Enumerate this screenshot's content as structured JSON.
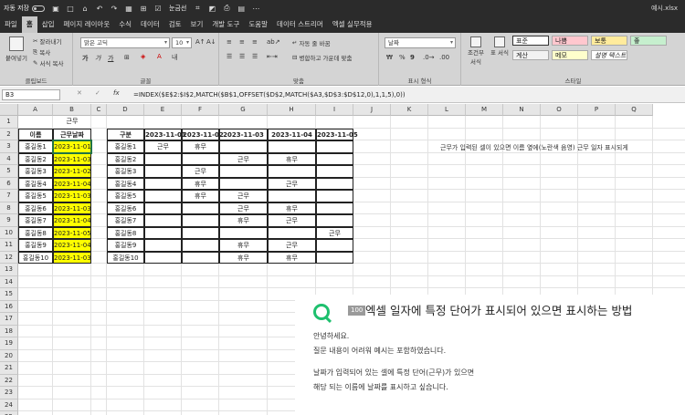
{
  "titlebar": {
    "autosave": "자동 저장",
    "font_indicator": "눈금선",
    "filename": "예시.xlsx"
  },
  "menu": {
    "tabs": [
      "파일",
      "홈",
      "삽입",
      "페이지 레이아웃",
      "수식",
      "데이터",
      "검토",
      "보기",
      "개발 도구",
      "도움말",
      "데이터 스트리머",
      "엑셀 실무적용"
    ],
    "active": "홈"
  },
  "ribbon": {
    "clipboard": {
      "label": "클립보드",
      "paste": "붙여넣기",
      "cut": "잘라내기",
      "copy": "복사",
      "format_painter": "서식 복사"
    },
    "font": {
      "label": "글꼴",
      "font_name": "맑은 고딕",
      "font_size": "10",
      "bold": "가",
      "italic": "가",
      "underline": "가"
    },
    "alignment": {
      "label": "맞춤",
      "wrap": "자동 줄 바꿈",
      "merge": "병합하고 가운데 맞춤"
    },
    "number": {
      "label": "표시 형식",
      "format": "날짜",
      "percent": "%",
      "comma": "9"
    },
    "styles": {
      "label": "스타일",
      "conditional": "조건부 서식",
      "table": "표 서식",
      "cells": [
        {
          "name": "표준",
          "color": "#ffffff"
        },
        {
          "name": "나쁨",
          "color": "#ffc7ce"
        },
        {
          "name": "보통",
          "color": "#ffeb9c"
        },
        {
          "name": "좋",
          "color": "#c6efce"
        },
        {
          "name": "계산",
          "color": "#f2f2f2"
        },
        {
          "name": "메모",
          "color": "#ffffcc"
        },
        {
          "name": "설명 텍스트",
          "color": "#ffffff"
        }
      ]
    }
  },
  "formula_bar": {
    "name_box": "B3",
    "formula": "=INDEX($E$2:$I$2,MATCH($B$1,OFFSET($D$2,MATCH($A3,$D$3:$D$12,0),1,1,5),0))"
  },
  "sheet": {
    "columns": [
      "A",
      "B",
      "C",
      "D",
      "E",
      "F",
      "G",
      "H",
      "I",
      "J",
      "K",
      "L",
      "M",
      "N",
      "O",
      "P",
      "Q"
    ],
    "rows": [
      "1",
      "2",
      "3",
      "4",
      "5",
      "6",
      "7",
      "8",
      "9",
      "10",
      "11",
      "12",
      "13",
      "14",
      "15",
      "16",
      "17",
      "18",
      "19",
      "20",
      "21",
      "22",
      "23",
      "24",
      "25"
    ],
    "b1": "근무",
    "left_headers": [
      "이름",
      "근무날짜"
    ],
    "left_rows": [
      [
        "홍길동1",
        "2023-11-01"
      ],
      [
        "홍길동2",
        "2023-11-03"
      ],
      [
        "홍길동3",
        "2023-11-02"
      ],
      [
        "홍길동4",
        "2023-11-04"
      ],
      [
        "홍길동5",
        "2023-11-03"
      ],
      [
        "홍길동6",
        "2023-11-03"
      ],
      [
        "홍길동7",
        "2023-11-04"
      ],
      [
        "홍길동8",
        "2023-11-05"
      ],
      [
        "홍길동9",
        "2023-11-04"
      ],
      [
        "홍길동10",
        "2023-11-03"
      ]
    ],
    "right_headers": [
      "구분",
      "2023-11-01",
      "2023-11-02",
      "2023-11-03",
      "2023-11-04",
      "2023-11-05"
    ],
    "right_rows": [
      [
        "홍길동1",
        "근무",
        "휴무",
        "",
        "",
        ""
      ],
      [
        "홍길동2",
        "",
        "",
        "근무",
        "휴무",
        ""
      ],
      [
        "홍길동3",
        "",
        "근무",
        "",
        "",
        ""
      ],
      [
        "홍길동4",
        "",
        "휴무",
        "",
        "근무",
        ""
      ],
      [
        "홍길동5",
        "",
        "휴무",
        "근무",
        "",
        ""
      ],
      [
        "홍길동6",
        "",
        "",
        "근무",
        "휴무",
        ""
      ],
      [
        "홍길동7",
        "",
        "",
        "휴무",
        "근무",
        ""
      ],
      [
        "홍길동8",
        "",
        "",
        "",
        "",
        "근무"
      ],
      [
        "홍길동9",
        "",
        "",
        "휴무",
        "근무",
        ""
      ],
      [
        "홍길동10",
        "",
        "",
        "휴무",
        "휴무",
        ""
      ]
    ],
    "note": "근무가 입력된 셀이 있으면 이름 옆에(노란색 음영) 근무 일자 표시되게"
  },
  "qa": {
    "badge": "100",
    "title": "엑셀 일자에 특정 단어가 표시되어 있으면 표시하는 방법",
    "lines": [
      "안녕하세요.",
      "질문 내용이 어려워 예시는 포함하였습니다.",
      "",
      "날짜가 입력되어 있는 셀에 특정 단어(근무)가 있으면",
      "해당 되는 이름에 날짜를 표시하고 싶습니다."
    ]
  }
}
